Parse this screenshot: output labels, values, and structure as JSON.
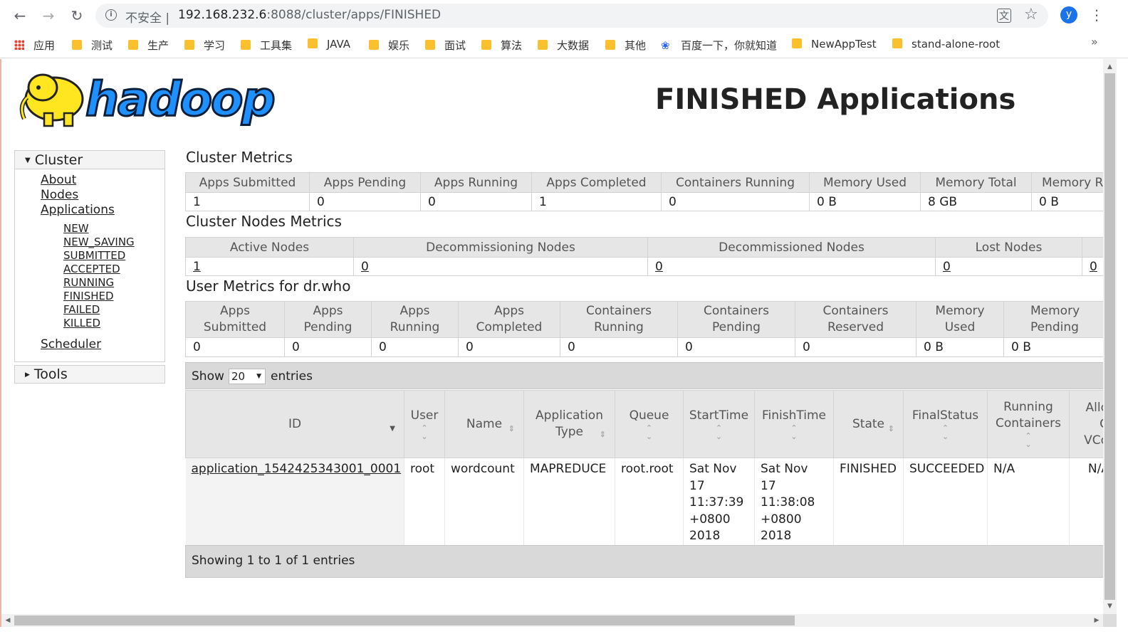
{
  "browser": {
    "back_icon": "←",
    "forward_icon": "→",
    "reload_icon": "↻",
    "security_text": "不安全",
    "url_host": "192.168.232.6",
    "url_path": ":8088/cluster/apps/FINISHED",
    "avatar_letter": "y",
    "bookmarks": [
      {
        "label": "应用",
        "icon": "apps-grid-icon"
      },
      {
        "label": "测试",
        "icon": "folder-icon"
      },
      {
        "label": "生产",
        "icon": "folder-icon"
      },
      {
        "label": "学习",
        "icon": "folder-icon"
      },
      {
        "label": "工具集",
        "icon": "folder-icon"
      },
      {
        "label": "JAVA",
        "icon": "folder-icon"
      },
      {
        "label": "娱乐",
        "icon": "folder-icon"
      },
      {
        "label": "面试",
        "icon": "folder-icon"
      },
      {
        "label": "算法",
        "icon": "folder-icon"
      },
      {
        "label": "大数据",
        "icon": "folder-icon"
      },
      {
        "label": "其他",
        "icon": "folder-icon"
      },
      {
        "label": "百度一下，你就知道",
        "icon": "baidu-paw-icon"
      },
      {
        "label": "NewAppTest",
        "icon": "folder-icon"
      },
      {
        "label": "stand-alone-root",
        "icon": "folder-icon"
      }
    ],
    "bookmarks_more": "»"
  },
  "page": {
    "logo_text": "hadoop",
    "title": "FINISHED Applications"
  },
  "sidebar": {
    "cluster_header": "Cluster",
    "links": [
      "About",
      "Nodes",
      "Applications"
    ],
    "app_states": [
      "NEW",
      "NEW_SAVING",
      "SUBMITTED",
      "ACCEPTED",
      "RUNNING",
      "FINISHED",
      "FAILED",
      "KILLED"
    ],
    "scheduler": "Scheduler",
    "tools_header": "Tools"
  },
  "cluster_metrics": {
    "title": "Cluster Metrics",
    "headers": [
      "Apps Submitted",
      "Apps Pending",
      "Apps Running",
      "Apps Completed",
      "Containers Running",
      "Memory Used",
      "Memory Total",
      "Memory Reserved"
    ],
    "values": [
      "1",
      "0",
      "0",
      "1",
      "0",
      "0 B",
      "8 GB",
      "0 B"
    ]
  },
  "cluster_nodes_metrics": {
    "title": "Cluster Nodes Metrics",
    "headers": [
      "Active Nodes",
      "Decommissioning Nodes",
      "Decommissioned Nodes",
      "Lost Nodes",
      ""
    ],
    "values": [
      "1",
      "0",
      "0",
      "0",
      "0"
    ]
  },
  "user_metrics": {
    "title": "User Metrics for dr.who",
    "headers": [
      [
        "Apps",
        "Submitted"
      ],
      [
        "Apps",
        "Pending"
      ],
      [
        "Apps",
        "Running"
      ],
      [
        "Apps",
        "Completed"
      ],
      [
        "Containers",
        "Running"
      ],
      [
        "Containers",
        "Pending"
      ],
      [
        "Containers",
        "Reserved"
      ],
      [
        "Memory",
        "Used"
      ],
      [
        "Memory",
        "Pending"
      ]
    ],
    "values": [
      "0",
      "0",
      "0",
      "0",
      "0",
      "0",
      "0",
      "0 B",
      "0 B"
    ]
  },
  "apps_table": {
    "show_label": "Show",
    "entries_label": "entries",
    "page_size": "20",
    "headers": [
      [
        "ID"
      ],
      [
        "User"
      ],
      [
        "Name"
      ],
      [
        "Application",
        "Type"
      ],
      [
        "Queue"
      ],
      [
        "StartTime"
      ],
      [
        "FinishTime"
      ],
      [
        "State"
      ],
      [
        "FinalStatus"
      ],
      [
        "Running",
        "Containers"
      ],
      [
        "Allo",
        "C",
        "VCo"
      ]
    ],
    "rows": [
      {
        "id": "application_1542425343001_0001",
        "user": "root",
        "name": "wordcount",
        "type": "MAPREDUCE",
        "queue": "root.root",
        "start": [
          "Sat Nov",
          "17",
          "11:37:39",
          "+0800",
          "2018"
        ],
        "finish": [
          "Sat Nov",
          "17",
          "11:38:08",
          "+0800",
          "2018"
        ],
        "state": "FINISHED",
        "final_status": "SUCCEEDED",
        "running_containers": "N/A",
        "allocated": "N/A"
      }
    ],
    "footer": "Showing 1 to 1 of 1 entries"
  }
}
